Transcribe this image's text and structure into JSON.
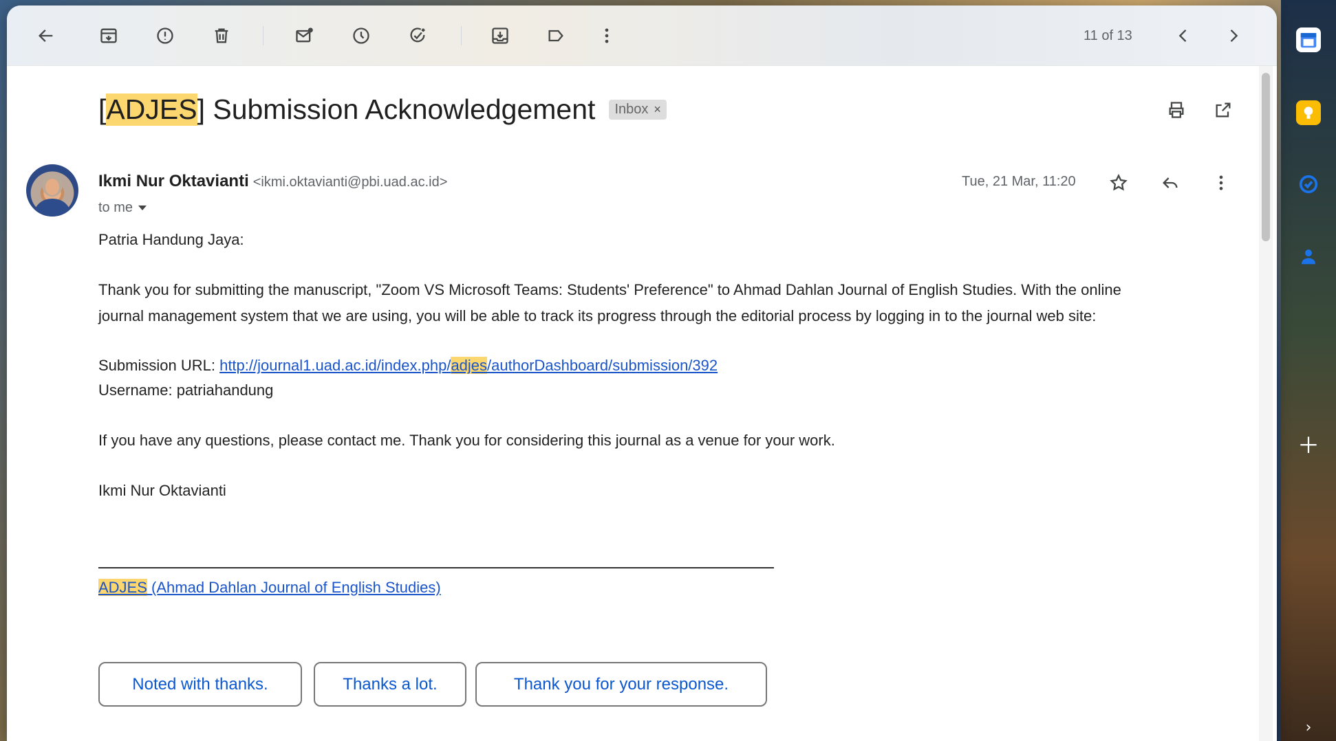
{
  "toolbar": {
    "pager": "11 of 13"
  },
  "email": {
    "subject_highlight": "ADJES",
    "subject_rest": "] Submission Acknowledgement",
    "subject_open": "[",
    "label": "Inbox",
    "label_remove": "×",
    "sender_name": "Ikmi Nur Oktavianti",
    "sender_email": "<ikmi.oktavianti@pbi.uad.ac.id>",
    "recipient": "to me",
    "date": "Tue, 21 Mar, 11:20",
    "greeting": "Patria Handung Jaya:",
    "para1_line1": "Thank you for submitting the manuscript, \"Zoom VS Microsoft Teams: Students' Preference\" to Ahmad Dahlan Journal of English Studies. With the online",
    "para1_line2": "journal management system that we are using, you will be able to track its progress through the editorial process by logging in to the journal web site:",
    "url_label": "Submission URL: ",
    "url_part1": "http://journal1.uad.ac.id/index.php/",
    "url_highlight": "adjes",
    "url_part2": "/authorDashboard/submission/392",
    "username_line": "Username: patriahandung",
    "para2": "If you have any questions, please contact me. Thank you for considering this journal as a venue for your work.",
    "signature": "Ikmi Nur Oktavianti",
    "footer_highlight": "ADJES",
    "footer_link": " (Ahmad Dahlan Journal of English Studies)"
  },
  "smart_replies": [
    "Noted with thanks.",
    "Thanks a lot.",
    "Thank you for your response."
  ],
  "icons": {
    "back": "arrow-left-icon",
    "archive": "archive-icon",
    "spam": "report-spam-icon",
    "delete": "trash-icon",
    "unread": "mark-unread-icon",
    "snooze": "snooze-clock-icon",
    "task": "add-task-icon",
    "move": "move-to-icon",
    "label": "label-icon",
    "more": "more-vertical-icon",
    "prev": "chevron-left-icon",
    "next": "chevron-right-icon",
    "print": "print-icon",
    "popout": "open-new-window-icon",
    "star": "star-icon",
    "reply": "reply-icon"
  },
  "colors": {
    "highlight": "#fcd66f",
    "link": "#1a54c9",
    "chip_text": "#0b57d0"
  }
}
